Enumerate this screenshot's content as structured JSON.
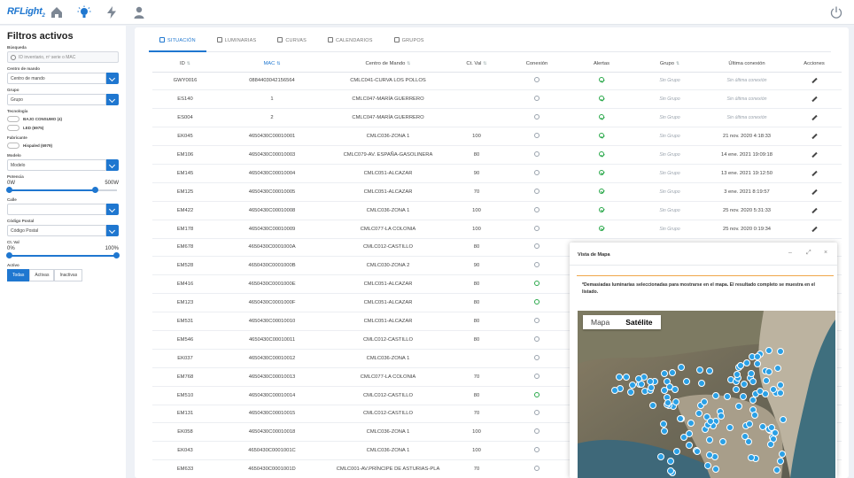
{
  "app": {
    "logo_main": "RFLight",
    "logo_sub": "2"
  },
  "colors": {
    "accent": "#1f77d0",
    "ok": "#2aa84a",
    "muted": "#9aa3ad",
    "pin": "#2aa0e6",
    "warn": "#f0a64a"
  },
  "nav": [
    {
      "name": "home-icon",
      "active": false
    },
    {
      "name": "lightbulb-icon",
      "active": true
    },
    {
      "name": "lightning-icon",
      "active": false
    },
    {
      "name": "user-icon",
      "active": false
    }
  ],
  "sidebar": {
    "title": "Filtros activos",
    "search_label": "Búsqueda",
    "search_placeholder": "ID inventario, nº serie o MAC",
    "centro_label": "Centro de mando",
    "centro_value": "Centro de mando",
    "grupo_label": "Grupo",
    "grupo_value": "Grupo",
    "tecnologia_label": "Tecnología",
    "tec_options": [
      "BAJO CONSUMO (4)",
      "LED (6975)"
    ],
    "fabricante_label": "Fabricante",
    "fab_options": [
      "Hispaled (6979)"
    ],
    "modelo_label": "Modelo",
    "modelo_value": "Modelo",
    "potencia_label": "Potencia",
    "potencia_min": "0W",
    "potencia_max": "500W",
    "potencia_range": [
      0,
      0.8
    ],
    "calle_label": "Calle",
    "calle_value": "",
    "cp_label": "Código Postal",
    "cp_value": "Código Postal",
    "ctval_label": "Ct. Val",
    "ctval_min": "0%",
    "ctval_max": "100%",
    "ctval_range": [
      0,
      1
    ],
    "activo_label": "Activo",
    "activo_options": [
      "Todas",
      "Activas",
      "Inactivas"
    ],
    "activo_selected": 0
  },
  "tabs": [
    "Situación",
    "Luminarias",
    "Curvas",
    "Calendarios",
    "Grupos"
  ],
  "table": {
    "headers": [
      "ID",
      "MAC",
      "Centro de Mando",
      "Ct. Val",
      "Conexión",
      "Alertas",
      "Grupo",
      "Última conexión",
      "Acciones"
    ],
    "rows": [
      [
        "GWY0016",
        "0884403042156564",
        "CMLC041-CURVA LOS POLLOS",
        "",
        "off",
        "ok",
        "Sin Grupo",
        "Sin última conexión"
      ],
      [
        "ES140",
        "1",
        "CMLC047-MARÍA GUERRERO",
        "",
        "off",
        "ok",
        "Sin Grupo",
        "Sin última conexión"
      ],
      [
        "ES004",
        "2",
        "CMLC047-MARÍA GUERRERO",
        "",
        "off",
        "ok",
        "Sin Grupo",
        "Sin última conexión"
      ],
      [
        "EK045",
        "4650430C00010001",
        "CMLC036-ZONA 1",
        "100",
        "off",
        "ok",
        "Sin Grupo",
        "21 nov. 2020 4:18:33"
      ],
      [
        "EM106",
        "4650430C00010003",
        "CMLC079-AV. ESPAÑA-GASOLINERA",
        "80",
        "off",
        "ok",
        "Sin Grupo",
        "14 ene. 2021 19:09:18"
      ],
      [
        "EM145",
        "4650430C00010004",
        "CMLC051-ALCAZAR",
        "90",
        "off",
        "ok",
        "Sin Grupo",
        "13 ene. 2021 19:12:50"
      ],
      [
        "EM125",
        "4650430C00010005",
        "CMLC051-ALCAZAR",
        "70",
        "off",
        "ok",
        "Sin Grupo",
        "3 ene. 2021 8:19:57"
      ],
      [
        "EM422",
        "4650430C00010008",
        "CMLC036-ZONA 1",
        "100",
        "off",
        "ok",
        "Sin Grupo",
        "25 nov. 2020 5:31:33"
      ],
      [
        "EM178",
        "4650430C00010009",
        "CMLC077-LA COLONIA",
        "100",
        "off",
        "ok",
        "Sin Grupo",
        "25 nov. 2020 0:19:34"
      ],
      [
        "EM678",
        "4650430C0001000A",
        "CMLC012-CASTILLO",
        "80",
        "off",
        "",
        "",
        ""
      ],
      [
        "EM528",
        "4650430C0001000B",
        "CMLC030-ZONA 2",
        "90",
        "off",
        "",
        "",
        ""
      ],
      [
        "EM416",
        "4650430C0001000E",
        "CMLC051-ALCAZAR",
        "80",
        "on",
        "",
        "",
        ""
      ],
      [
        "EM123",
        "4650430C0001000F",
        "CMLC051-ALCAZAR",
        "80",
        "on",
        "",
        "",
        ""
      ],
      [
        "EM531",
        "4650430C00010010",
        "CMLC051-ALCAZAR",
        "80",
        "off",
        "",
        "",
        ""
      ],
      [
        "EM546",
        "4650430C00010011",
        "CMLC012-CASTILLO",
        "80",
        "off",
        "",
        "",
        ""
      ],
      [
        "EK037",
        "4650430C00010012",
        "CMLC036-ZONA 1",
        "",
        "off",
        "",
        "",
        ""
      ],
      [
        "EM768",
        "4650430C00010013",
        "CMLC077-LA COLONIA",
        "70",
        "off",
        "",
        "",
        ""
      ],
      [
        "EM510",
        "4650430C00010014",
        "CMLC012-CASTILLO",
        "80",
        "on",
        "",
        "",
        ""
      ],
      [
        "EM131",
        "4650430C00010015",
        "CMLC012-CASTILLO",
        "70",
        "off",
        "",
        "",
        ""
      ],
      [
        "EK058",
        "4650430C00010018",
        "CMLC036-ZONA 1",
        "100",
        "off",
        "",
        "",
        ""
      ],
      [
        "EK043",
        "4650430C0001001C",
        "CMLC036-ZONA 1",
        "100",
        "off",
        "",
        "",
        ""
      ],
      [
        "EM633",
        "4650430C0001001D",
        "CMLC001-AV.PRÍNCIPE DE ASTURIAS-PLA",
        "70",
        "off",
        "",
        "",
        ""
      ]
    ]
  },
  "modal": {
    "title": "Vista de Mapa",
    "notice": "*Demasiadas luminarias seleccionadas para mostrarse en el mapa. El resultado completo se muestra en el listado.",
    "maptypes": [
      "Mapa",
      "Satélite"
    ],
    "maptype_selected": 1
  }
}
